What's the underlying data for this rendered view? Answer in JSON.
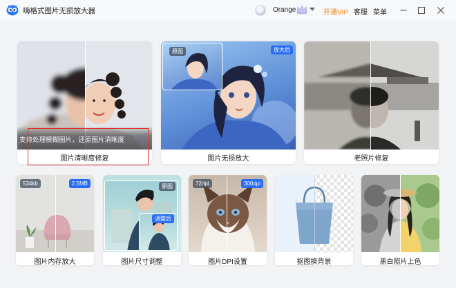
{
  "app": {
    "title": "嗨格式图片无损放大器"
  },
  "user": {
    "name": "Orange"
  },
  "header": {
    "open_vip": "开通VIP",
    "service": "客服",
    "menu": "菜单"
  },
  "colors": {
    "accent_orange": "#f08a1c",
    "tag_blue": "#2a6df4",
    "highlight_red": "#e0302a"
  },
  "icons": {
    "logo": "app-logo-icon",
    "vip": "vip-crown-icon",
    "minimize": "minimize-icon",
    "maximize": "maximize-icon",
    "close": "close-icon"
  },
  "features": {
    "clarity": {
      "label": "图片清晰度修复",
      "caption": "支持处理模糊图片，还原图片清晰度"
    },
    "enlarge": {
      "label": "图片无损放大",
      "tag_before": "原图",
      "tag_after": "放大后"
    },
    "old_photo": {
      "label": "老照片修复"
    },
    "memory": {
      "label": "图片内存放大",
      "tag_before": "534kb",
      "tag_after": "2.5MB"
    },
    "resize": {
      "label": "图片尺寸调整",
      "tag_before": "原图",
      "tag_after": "调整后"
    },
    "dpi": {
      "label": "图片DPI设置",
      "tag_before": "72dpi",
      "tag_after": "300dpi"
    },
    "matting": {
      "label": "抠图换背景"
    },
    "colorize": {
      "label": "黑白照片上色"
    }
  }
}
